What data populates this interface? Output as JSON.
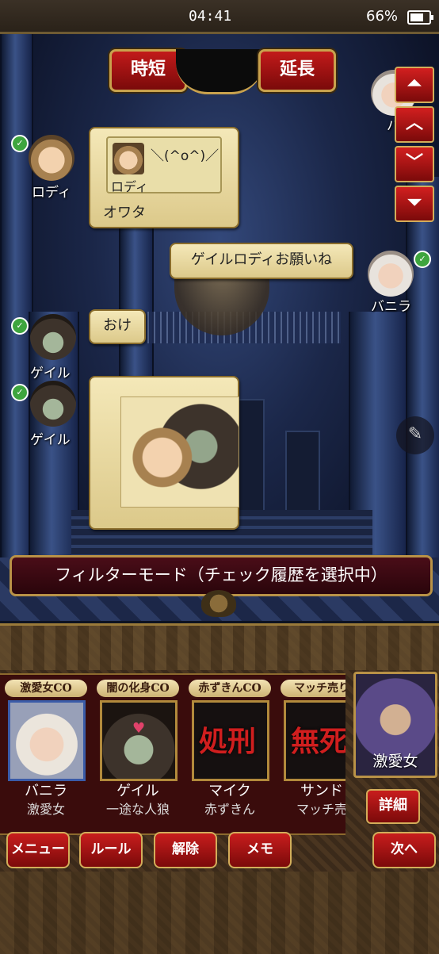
{
  "status": {
    "time": "04:41",
    "battery": "66%"
  },
  "tabs": {
    "shorten": "時短",
    "extend": "延長"
  },
  "arrows": {
    "top": "⏶",
    "up": "︿",
    "down": "﹀",
    "bottom": "⏷"
  },
  "messages": [
    {
      "speaker": "ロディ",
      "quote": {
        "name": "ロディ",
        "text": "＼(^o^)／"
      },
      "text": "オワタ"
    },
    {
      "speaker": "バニラ",
      "text": "ゲイルロディお願いね"
    },
    {
      "speaker": "ゲイル",
      "text": "おけ"
    },
    {
      "speaker": "ゲイル"
    }
  ],
  "side_peek_name": "バニ",
  "filter_text": "フィルターモード（チェック履歴を選択中）",
  "cards": [
    {
      "co": "激愛女CO",
      "name": "バニラ",
      "role": "激愛女"
    },
    {
      "co": "闇の化身CO",
      "name": "ゲイル",
      "role": "一途な人狼"
    },
    {
      "co": "赤ずきんCO",
      "name": "マイク",
      "role": "赤ずきん",
      "stamp": "処刑"
    },
    {
      "co": "マッチ売り",
      "name": "サンド",
      "role": "マッチ売",
      "stamp": "無死"
    }
  ],
  "feature_label": "激愛女",
  "buttons": {
    "detail": "詳細",
    "menu": "メニュー",
    "rule": "ルール",
    "release": "解除",
    "memo": "メモ",
    "next": "次へ"
  },
  "icons": {
    "check": "✓",
    "pencil": "✎",
    "heart": "♥"
  }
}
